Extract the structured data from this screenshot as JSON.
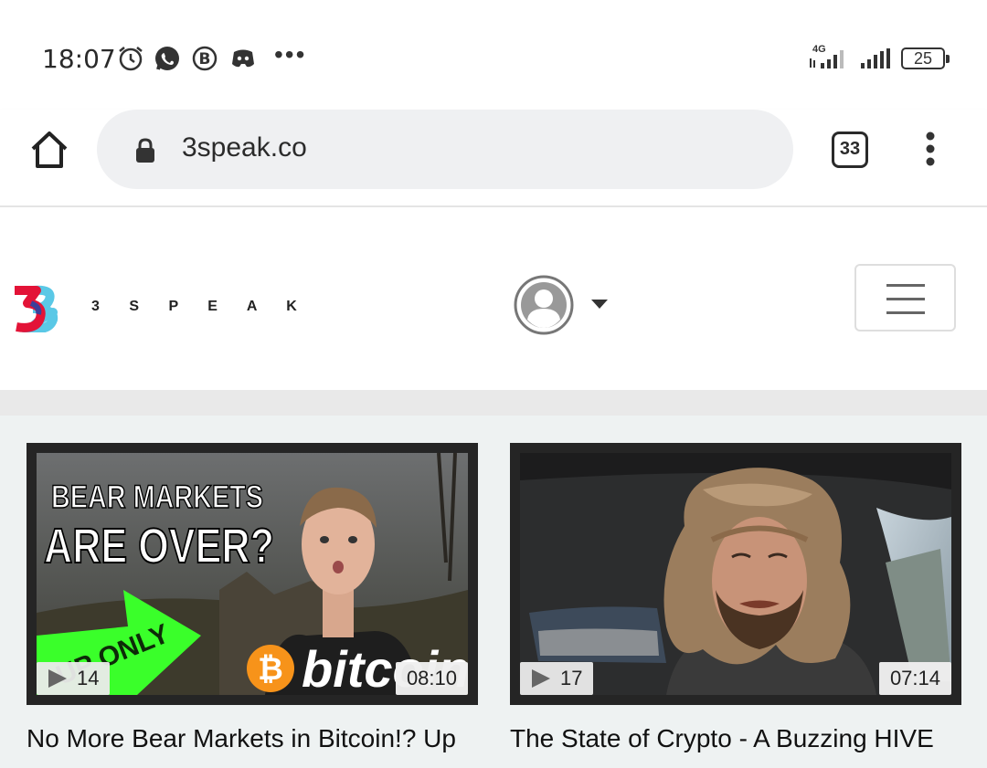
{
  "status_bar": {
    "time": "18:07",
    "icons": [
      "alarm-icon",
      "whatsapp-icon",
      "b-app-icon",
      "discord-icon"
    ],
    "more": "•••",
    "network": "4G",
    "battery": "25"
  },
  "browser": {
    "url": "3speak.co",
    "tab_count": "33"
  },
  "site": {
    "brand": "3 S P E A K",
    "colors": {
      "logo_red": "#e31337",
      "logo_blue": "#5ac8e6",
      "logo_dark": "#3b3f9a"
    }
  },
  "videos": [
    {
      "thumbnail_text": {
        "line1": "BEAR MARKETS",
        "line2": "ARE OVER?",
        "arrow": "UP ONLY",
        "coin": "bitcoin"
      },
      "views": "14",
      "duration": "08:10",
      "title": "No More Bear Markets in Bitcoin!? Up"
    },
    {
      "views": "17",
      "duration": "07:14",
      "title": "The State of Crypto - A Buzzing HIVE"
    }
  ]
}
